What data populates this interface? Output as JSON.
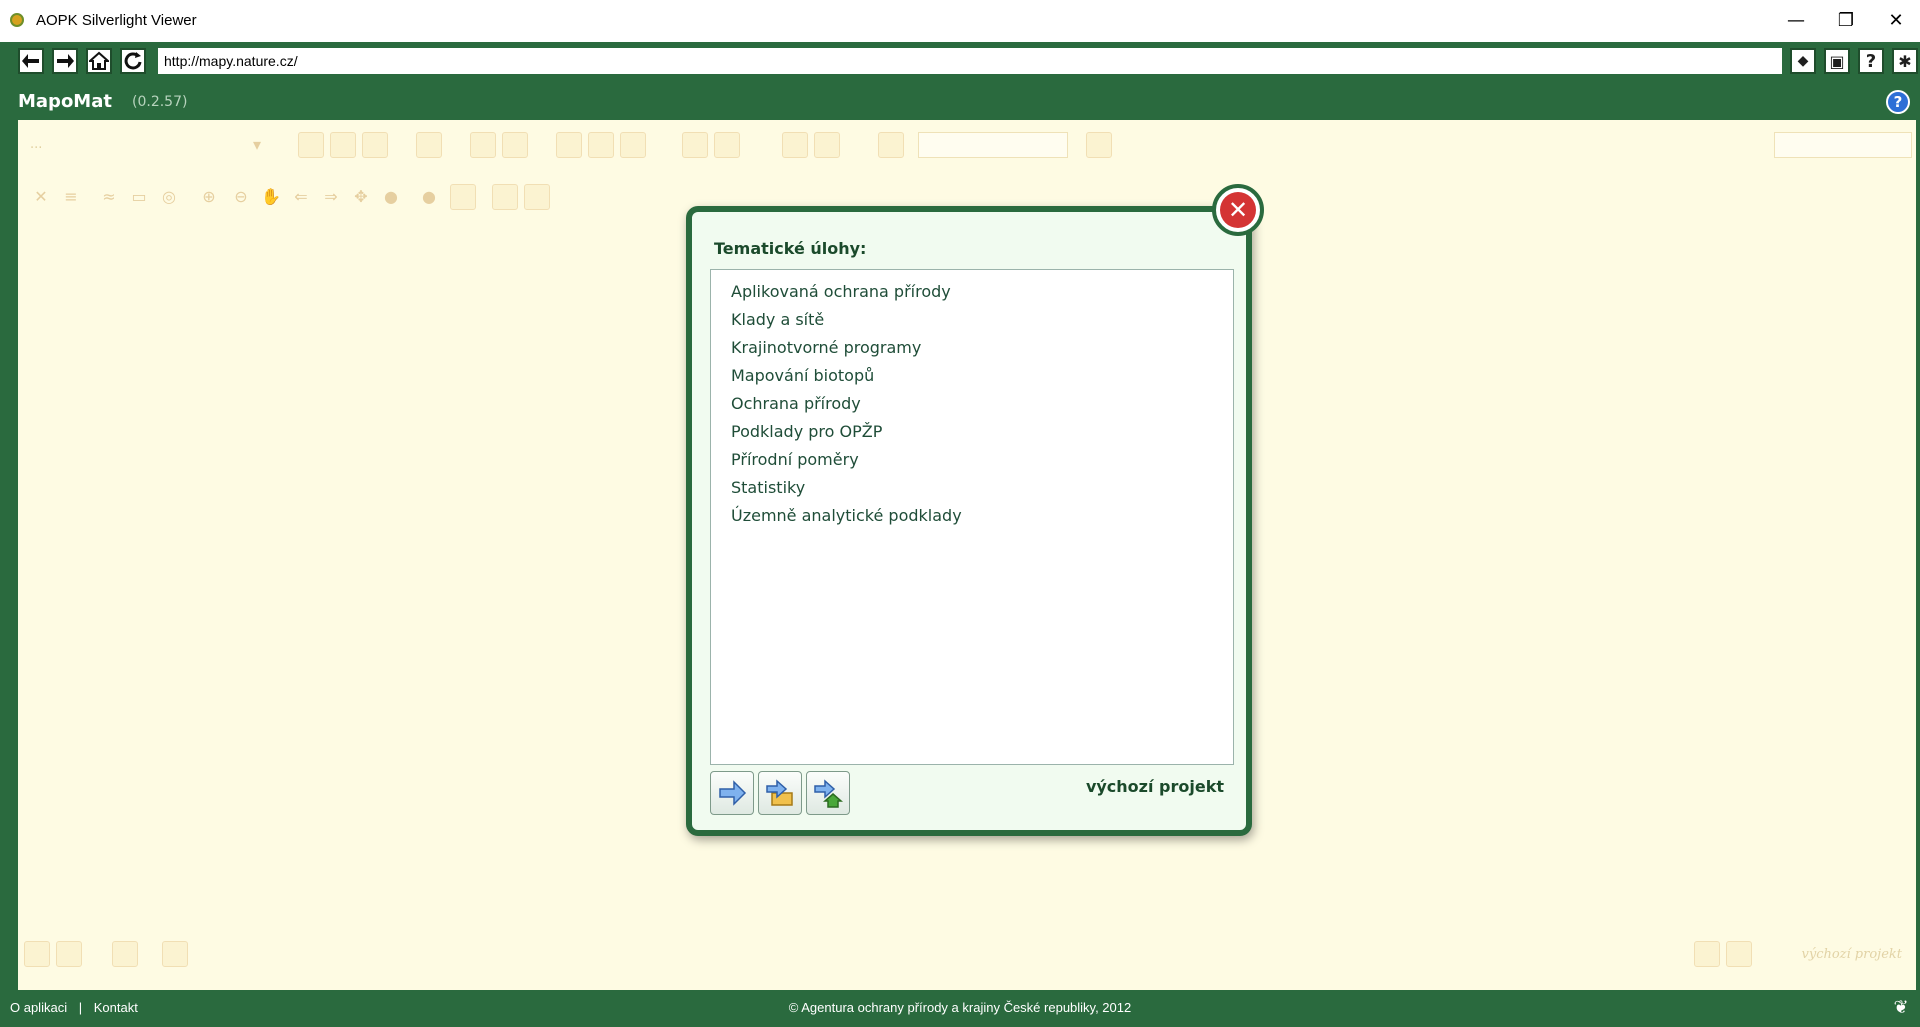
{
  "window": {
    "title": "AOPK Silverlight Viewer",
    "minimize": "—",
    "restore": "❐",
    "close": "✕"
  },
  "navbar": {
    "url": "http://mapy.nature.cz/",
    "right_help": "?"
  },
  "app": {
    "name": "MapoMat",
    "version": "(0.2.57)",
    "help": "?"
  },
  "toolbar": {
    "select_placeholder": "..."
  },
  "dialog": {
    "title": "Tematické úlohy:",
    "close": "✕",
    "tasks": [
      "Aplikovaná ochrana přírody",
      "Klady a sítě",
      "Krajinotvorné programy",
      "Mapování biotopů",
      "Ochrana přírody",
      "Podklady pro OPŽP",
      "Přírodní poměry",
      "Statistiky",
      "Územně analytické podklady"
    ],
    "default_project": "výchozí projekt"
  },
  "bottombar": {
    "default_project": "výchozí projekt"
  },
  "footer": {
    "about": "O aplikaci",
    "separator": "|",
    "contact": "Kontakt",
    "copyright": "© Agentura ochrany přírody a krajiny České republiky, 2012"
  },
  "colors": {
    "brand_green": "#2a6a3e",
    "background": "#fefbe3",
    "close_red": "#d43434"
  }
}
